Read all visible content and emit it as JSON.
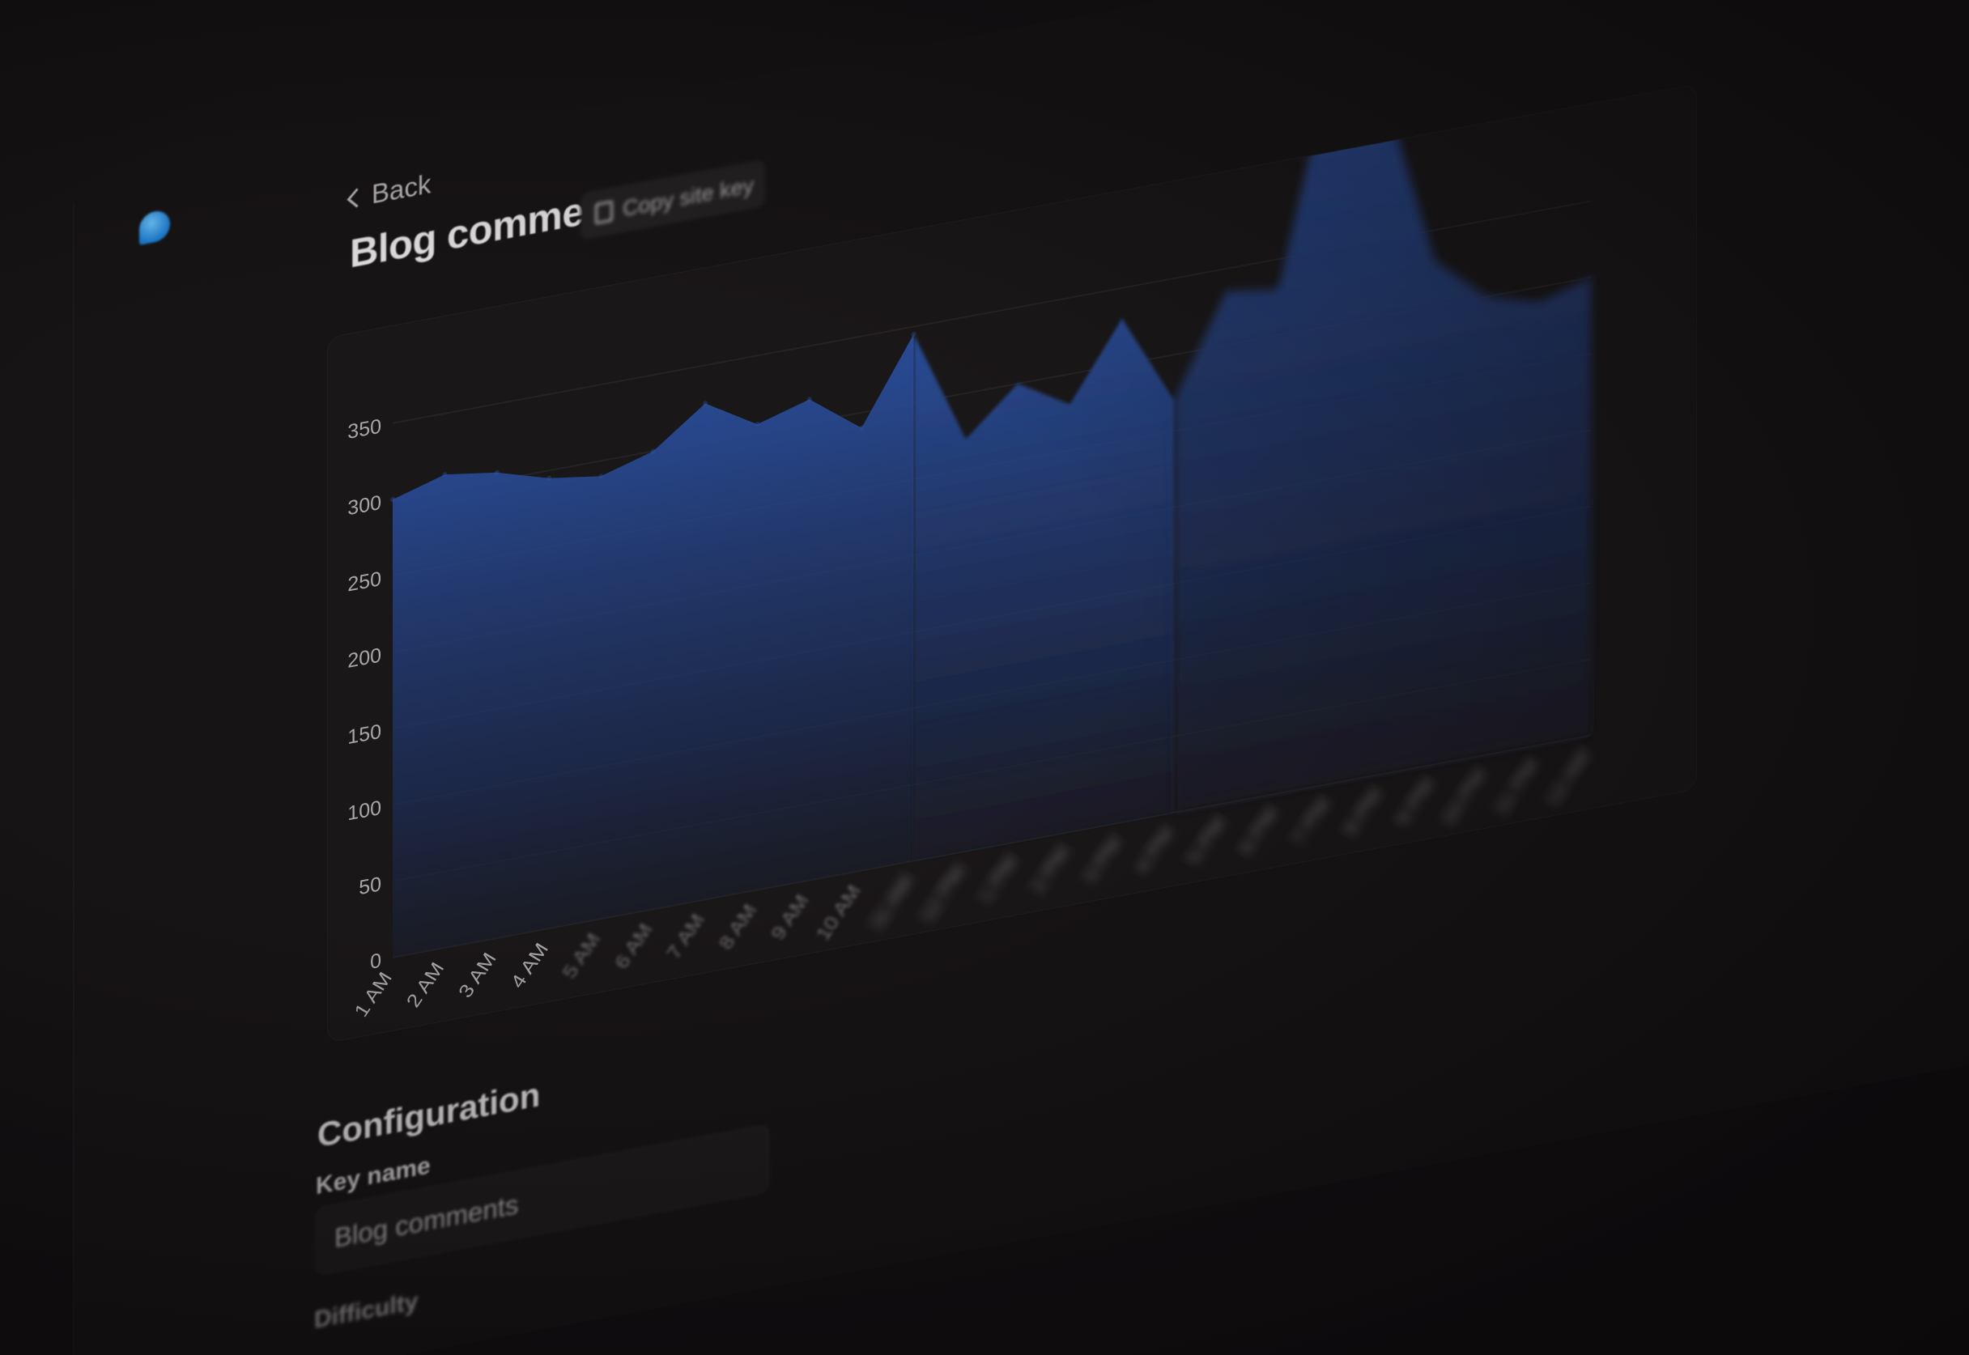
{
  "header": {
    "back_label": "Back",
    "title": "Blog comments",
    "copy_button_label": "Copy site key"
  },
  "config": {
    "section_title": "Configuration",
    "key_name_label": "Key name",
    "key_name_value": "Blog comments",
    "difficulty_label": "Difficulty"
  },
  "colors": {
    "accent": "#2a4f9e",
    "brand": "#3ea6f5"
  },
  "icons": [
    "brand-logo-icon",
    "chevron-left-icon",
    "copy-icon"
  ],
  "chart_data": {
    "type": "area",
    "categories": [
      "1 AM",
      "2 AM",
      "3 AM",
      "4 AM",
      "5 AM",
      "6 AM",
      "7 AM",
      "8 AM",
      "9 AM",
      "10 AM",
      "11 AM",
      "12 PM",
      "1 PM",
      "2 PM",
      "3 PM",
      "4 PM",
      "5 PM",
      "6 PM",
      "7 PM",
      "8 PM",
      "9 PM",
      "10 PM",
      "11 PM",
      "12 AM"
    ],
    "series": [
      {
        "values": [
          300,
          310,
          305,
          295,
          290,
          300,
          325,
          305,
          315,
          290,
          345,
          270,
          300,
          280,
          330,
          270,
          335,
          330,
          470,
          450,
          330,
          300,
          290,
          300
        ]
      }
    ],
    "y_ticks": [
      "0",
      "50",
      "100",
      "150",
      "200",
      "250",
      "300",
      "350"
    ],
    "ylim": [
      0,
      350
    ],
    "grid": true
  }
}
